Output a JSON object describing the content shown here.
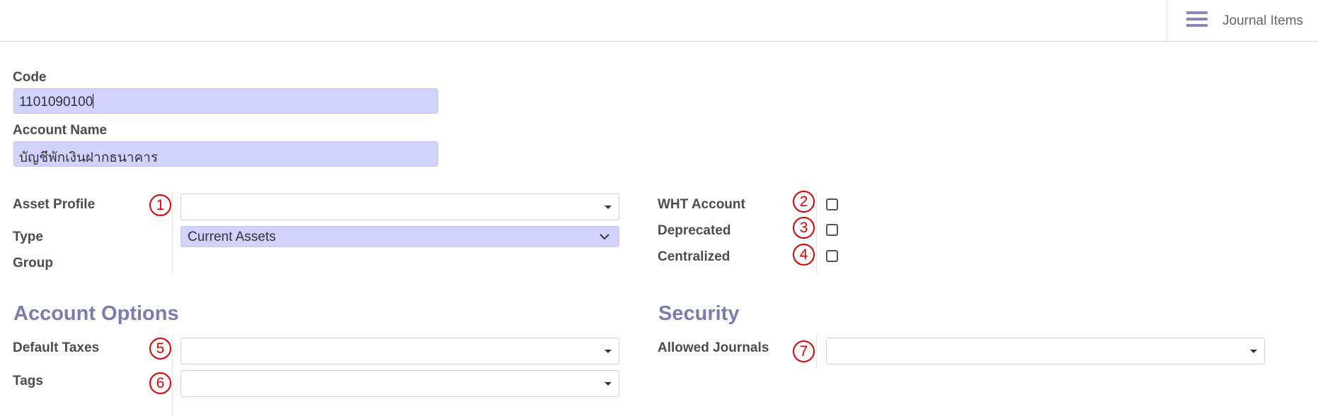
{
  "header": {
    "smart_button": {
      "label": "Journal Items",
      "icon": "hamburger-menu-icon"
    }
  },
  "form": {
    "code": {
      "label": "Code",
      "value": "1101090100"
    },
    "account_name": {
      "label": "Account Name",
      "value": "บัญชีพักเงินฝากธนาคาร"
    },
    "asset_profile": {
      "label": "Asset Profile",
      "value": "",
      "marker": "1"
    },
    "type": {
      "label": "Type",
      "value": "Current Assets"
    },
    "group": {
      "label": "Group",
      "value": ""
    },
    "wht_account": {
      "label": "WHT Account",
      "checked": false,
      "marker": "2"
    },
    "deprecated": {
      "label": "Deprecated",
      "checked": false,
      "marker": "3"
    },
    "centralized": {
      "label": "Centralized",
      "checked": false,
      "marker": "4"
    }
  },
  "account_options": {
    "title": "Account Options",
    "default_taxes": {
      "label": "Default Taxes",
      "value": "",
      "marker": "5"
    },
    "tags": {
      "label": "Tags",
      "value": "",
      "marker": "6"
    }
  },
  "security": {
    "title": "Security",
    "allowed_journals": {
      "label": "Allowed Journals",
      "value": "",
      "marker": "7"
    }
  },
  "colors": {
    "accent": "#7c7bad",
    "input_highlight": "#d2d2ff",
    "annotation_red": "#e00000"
  }
}
